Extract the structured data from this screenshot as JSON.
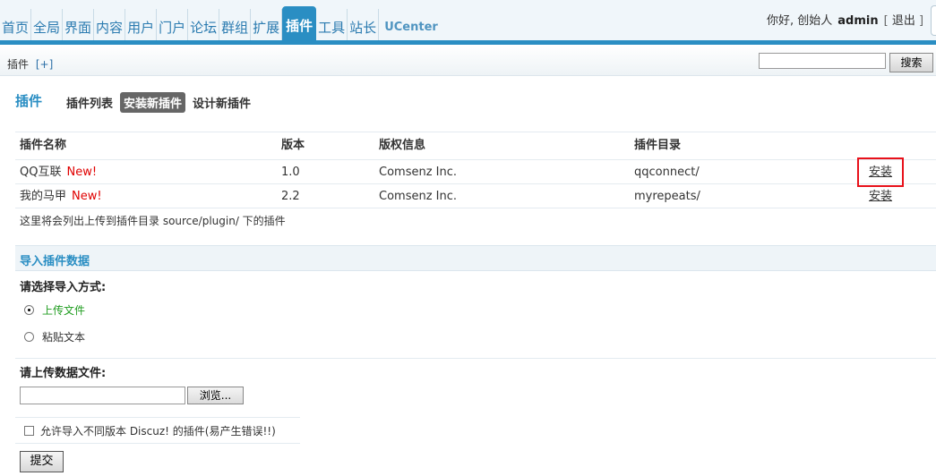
{
  "nav": {
    "items": [
      "首页",
      "全局",
      "界面",
      "内容",
      "用户",
      "门户",
      "论坛",
      "群组",
      "扩展",
      "插件",
      "工具",
      "站长",
      "UCenter"
    ],
    "active": "插件"
  },
  "user": {
    "greeting": "你好, 创始人",
    "name": "admin",
    "bracket_open": "[",
    "logout": "退出",
    "bracket_close": "]"
  },
  "subbar": {
    "crumb": "插件",
    "add": "[+]",
    "search_value": "",
    "search_button": "搜索"
  },
  "page": {
    "title": "插件",
    "tabs": [
      {
        "label": "插件列表",
        "active": false
      },
      {
        "label": "安装新插件",
        "active": true
      },
      {
        "label": "设计新插件",
        "active": false
      }
    ]
  },
  "table": {
    "headers": [
      "插件名称",
      "版本",
      "版权信息",
      "插件目录",
      ""
    ],
    "rows": [
      {
        "name": "QQ互联",
        "badge": "New!",
        "version": "1.0",
        "copyright": "Comsenz Inc.",
        "dir": "qqconnect/",
        "action": "安装"
      },
      {
        "name": "我的马甲",
        "badge": "New!",
        "version": "2.2",
        "copyright": "Comsenz Inc.",
        "dir": "myrepeats/",
        "action": "安装"
      }
    ],
    "note": "这里将会列出上传到插件目录 source/plugin/ 下的插件"
  },
  "import": {
    "section_title": "导入插件数据",
    "method_label": "请选择导入方式:",
    "options": [
      {
        "label": "上传文件",
        "checked": true
      },
      {
        "label": "粘贴文本",
        "checked": false
      }
    ],
    "file_label": "请上传数据文件:",
    "file_value": "",
    "browse_button": "浏览...",
    "allow_label": "允许导入不同版本 Discuz! 的插件(易产生错误!!)",
    "allow_checked": false,
    "submit_button": "提交"
  },
  "colors": {
    "accent": "#2a8ec3",
    "new_badge": "#e00000",
    "selected_option": "#1f9c1f",
    "highlight_box": "#e8111a"
  }
}
